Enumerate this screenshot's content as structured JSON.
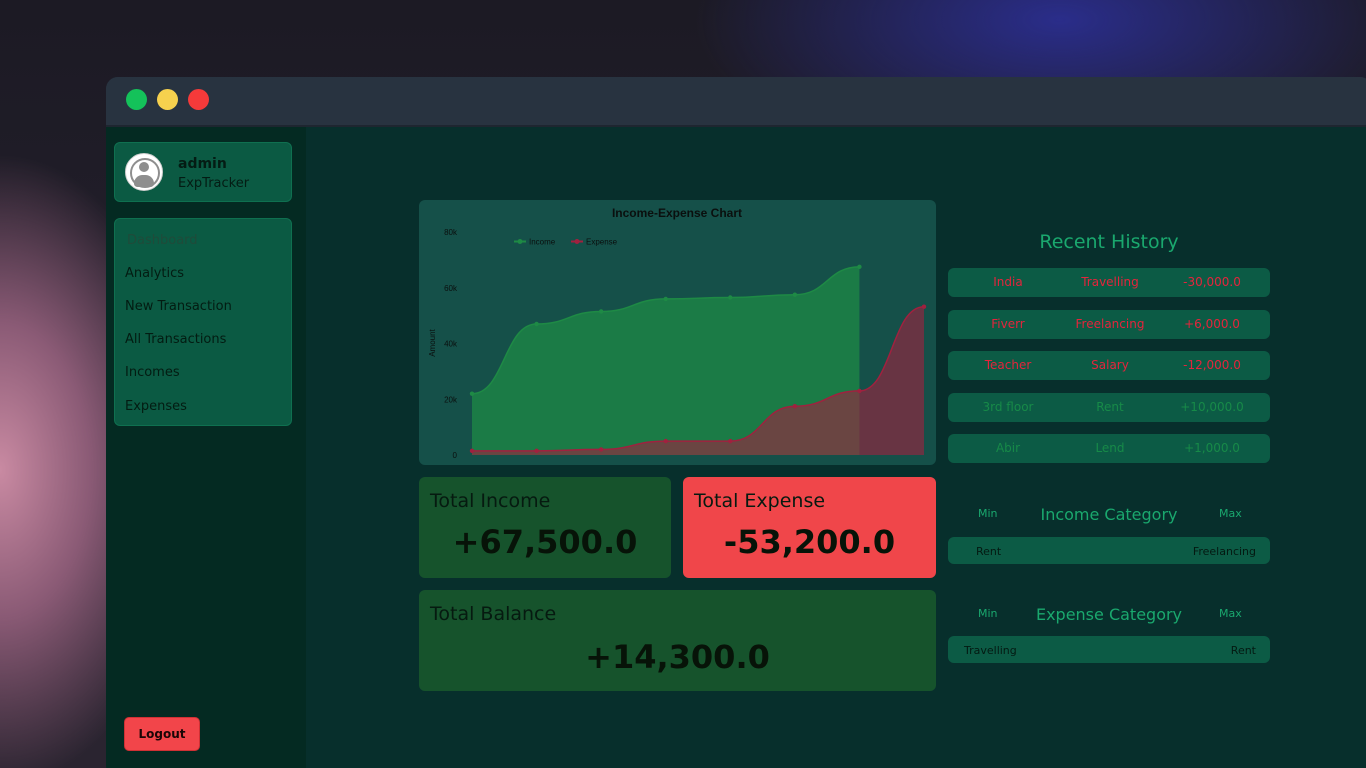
{
  "window": {
    "controls": [
      "close",
      "minimize",
      "maximize"
    ]
  },
  "user": {
    "name": "admin",
    "app": "ExpTracker"
  },
  "nav": [
    {
      "label": "Dashboard",
      "active": true
    },
    {
      "label": "Analytics"
    },
    {
      "label": "New Transaction"
    },
    {
      "label": "All Transactions"
    },
    {
      "label": "Incomes"
    },
    {
      "label": "Expenses"
    }
  ],
  "logout_label": "Logout",
  "chart_data": {
    "type": "area",
    "title": "Income-Expense Chart",
    "ylabel": "Amount",
    "ylim": [
      0,
      80000
    ],
    "yticks": [
      "0",
      "20k",
      "40k",
      "60k",
      "80k"
    ],
    "legend": "top-left",
    "series": [
      {
        "name": "Income",
        "color": "#1e8a45",
        "values": [
          22000,
          47000,
          51500,
          56000,
          56500,
          57500,
          67500
        ]
      },
      {
        "name": "Expense",
        "color": "#a0213f",
        "values": [
          1500,
          1500,
          2000,
          5000,
          5000,
          17500,
          23000,
          53200
        ]
      }
    ]
  },
  "totals": {
    "income_label": "Total Income",
    "income_value": "+67,500.0",
    "expense_label": "Total Expense",
    "expense_value": "-53,200.0",
    "balance_label": "Total Balance",
    "balance_value": "+14,300.0"
  },
  "recent_history": {
    "title": "Recent History",
    "rows": [
      {
        "name": "India",
        "category": "Travelling",
        "amount": "-30,000.0",
        "type": "expense"
      },
      {
        "name": "Fiverr",
        "category": "Freelancing",
        "amount": "+6,000.0",
        "type": "expense"
      },
      {
        "name": "Teacher",
        "category": "Salary",
        "amount": "-12,000.0",
        "type": "expense"
      },
      {
        "name": "3rd floor",
        "category": "Rent",
        "amount": "+10,000.0",
        "type": "income"
      },
      {
        "name": "Abir",
        "category": "Lend",
        "amount": "+1,000.0",
        "type": "income"
      }
    ]
  },
  "income_category": {
    "title": "Income Category",
    "min_label": "Min",
    "max_label": "Max",
    "min_value": "Rent",
    "max_value": "Freelancing"
  },
  "expense_category": {
    "title": "Expense Category",
    "min_label": "Min",
    "max_label": "Max",
    "min_value": "Travelling",
    "max_value": "Rent"
  },
  "colors": {
    "expense_text": "#e5243c",
    "income_text": "#178a48"
  }
}
